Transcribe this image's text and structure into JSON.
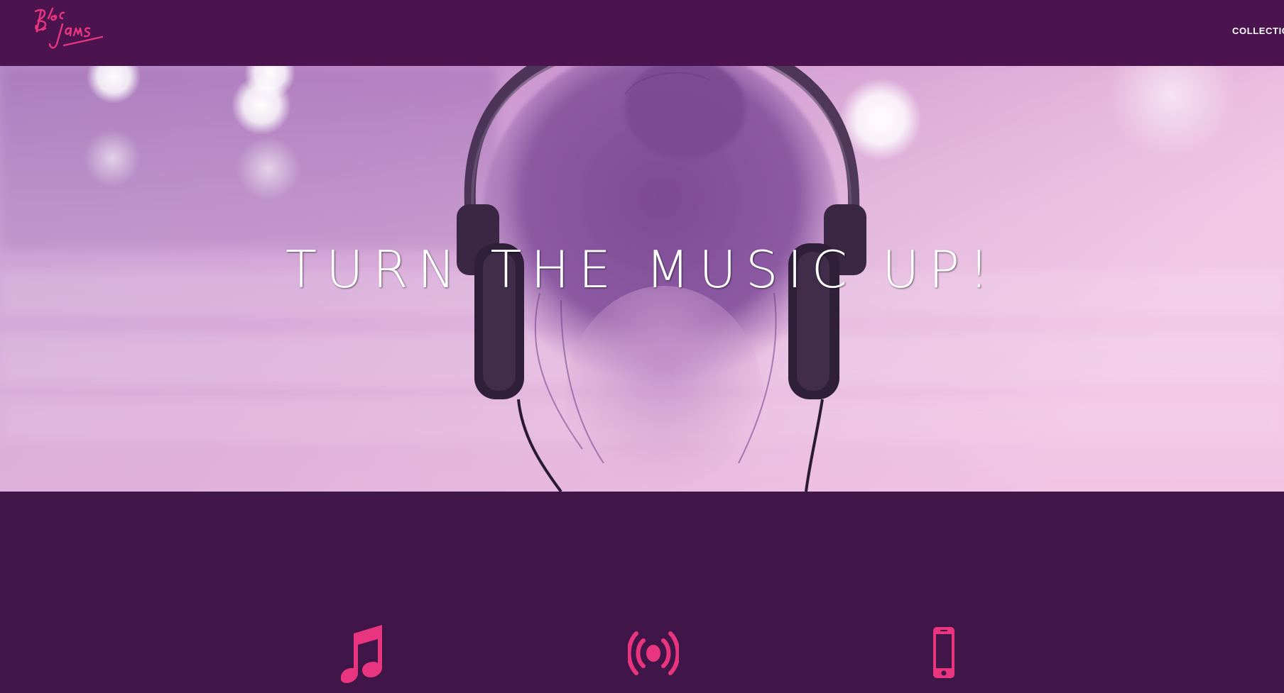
{
  "navbar": {
    "logo_text": "Bloc Jams",
    "nav_link": "COLLECTION"
  },
  "hero": {
    "title": "TURN THE MUSIC UP!"
  },
  "selling_points": {
    "icons": [
      "music-note-icon",
      "broadcast-icon",
      "mobile-phone-icon"
    ]
  },
  "colors": {
    "navbar_bg": "#4b144f",
    "section_bg": "#3f1647",
    "accent_pink": "#e9357f"
  }
}
